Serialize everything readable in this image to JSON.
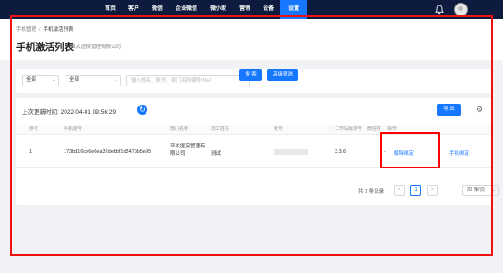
{
  "nav": {
    "items": [
      "首页",
      "客户",
      "微信",
      "企业微信",
      "微小助",
      "营销",
      "设备",
      "设置"
    ],
    "active_index": 7
  },
  "header": {
    "breadcrumb": [
      "手机管理",
      "手机激活列表"
    ],
    "title": "手机激活列表",
    "company": "亚太医院管理有限公司"
  },
  "filters": {
    "select1": "全部",
    "select2": "全部",
    "search_placeholder": "输入姓名、账号、部门名称编号IMEI",
    "search_button": "搜 索",
    "advanced_button": "高级筛选"
  },
  "toolbar": {
    "update_label": "上次更新时间: 2022-04-01 09:56:29",
    "export_label": "导 出"
  },
  "table": {
    "headers": [
      "序号",
      "手机编号",
      "部门名称",
      "员工姓名",
      "账号",
      "工作站版本号",
      "微信号",
      "操作"
    ],
    "rows": [
      {
        "index": "1",
        "phone_id": "173bd16ce6e6ea32debbf1d3473b5e95",
        "department": "亚太医院管理有限公司",
        "employee": "测试",
        "version": "3.3.6",
        "wechat": "-",
        "action_unbind": "解除绑定",
        "action_bind": "手机绑定"
      }
    ]
  },
  "pagination": {
    "total": "共 1 条记录",
    "prev": "<",
    "current": "1",
    "next": ">",
    "page_size": "20 条/页"
  },
  "colors": {
    "nav_bg": "#0d1b3e",
    "accent": "#1677ff",
    "annotation": "#ff0000"
  }
}
